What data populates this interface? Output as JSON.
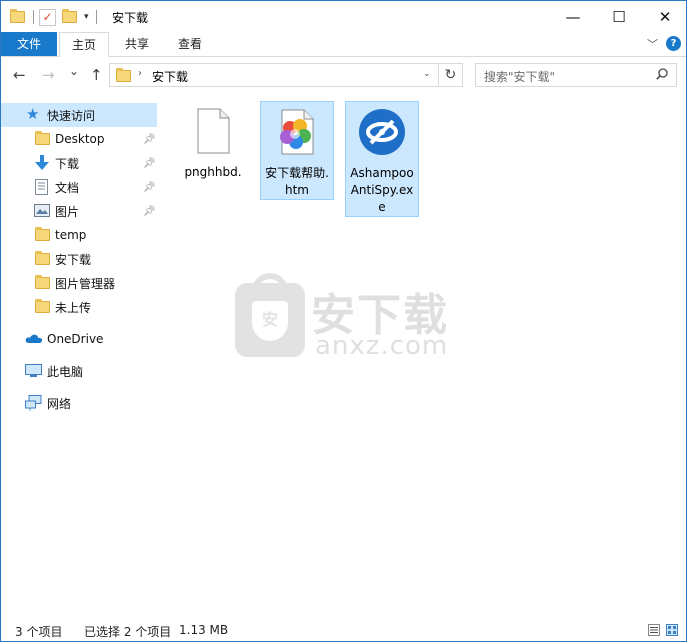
{
  "window": {
    "title": "安下载",
    "minimize_glyph": "—",
    "maximize_glyph": "☐",
    "close_glyph": "✕"
  },
  "quick_access": {
    "dropdown_glyph": "▾"
  },
  "ribbon": {
    "tabs": [
      {
        "label": "文件"
      },
      {
        "label": "主页"
      },
      {
        "label": "共享"
      },
      {
        "label": "查看"
      }
    ],
    "expand_glyph": "﹀",
    "help_glyph": "?"
  },
  "address": {
    "back_glyph": "←",
    "forward_glyph": "→",
    "recent_glyph": "⌄",
    "up_glyph": "↑",
    "separator_glyph": "›",
    "path": "安下载",
    "dropdown_glyph": "⌄",
    "refresh_glyph": "↻"
  },
  "search": {
    "placeholder": "搜索\"安下载\""
  },
  "sidebar": {
    "quick_access_label": "快速访问",
    "items": [
      {
        "label": "Desktop",
        "icon": "folder-icon",
        "pinned": true
      },
      {
        "label": "下载",
        "icon": "download-icon",
        "pinned": true
      },
      {
        "label": "文档",
        "icon": "documents-icon",
        "pinned": true
      },
      {
        "label": "图片",
        "icon": "pictures-icon",
        "pinned": true
      },
      {
        "label": "temp",
        "icon": "folder-icon",
        "pinned": false
      },
      {
        "label": "安下载",
        "icon": "folder-icon",
        "pinned": false
      },
      {
        "label": "图片管理器",
        "icon": "folder-icon",
        "pinned": false
      },
      {
        "label": "未上传",
        "icon": "folder-icon",
        "pinned": false
      }
    ],
    "onedrive_label": "OneDrive",
    "thispc_label": "此电脑",
    "network_label": "网络"
  },
  "files": [
    {
      "name": "pnghhbd.",
      "icon": "blank-file-icon",
      "selected": false
    },
    {
      "name": "安下载帮助.htm",
      "icon": "html-file-icon",
      "selected": true
    },
    {
      "name": "Ashampoo AntiSpy.exe",
      "icon": "antispy-app-icon",
      "selected": true
    }
  ],
  "watermark": {
    "line1": "安下载",
    "line2": "anxz.com",
    "badge": "安"
  },
  "status": {
    "item_count": "3 个项目",
    "selection": "已选择 2 个项目",
    "size": "1.13 MB"
  },
  "colors": {
    "accent": "#1979ca",
    "selection_bg": "#cce8ff",
    "selection_border": "#99d1ff"
  }
}
